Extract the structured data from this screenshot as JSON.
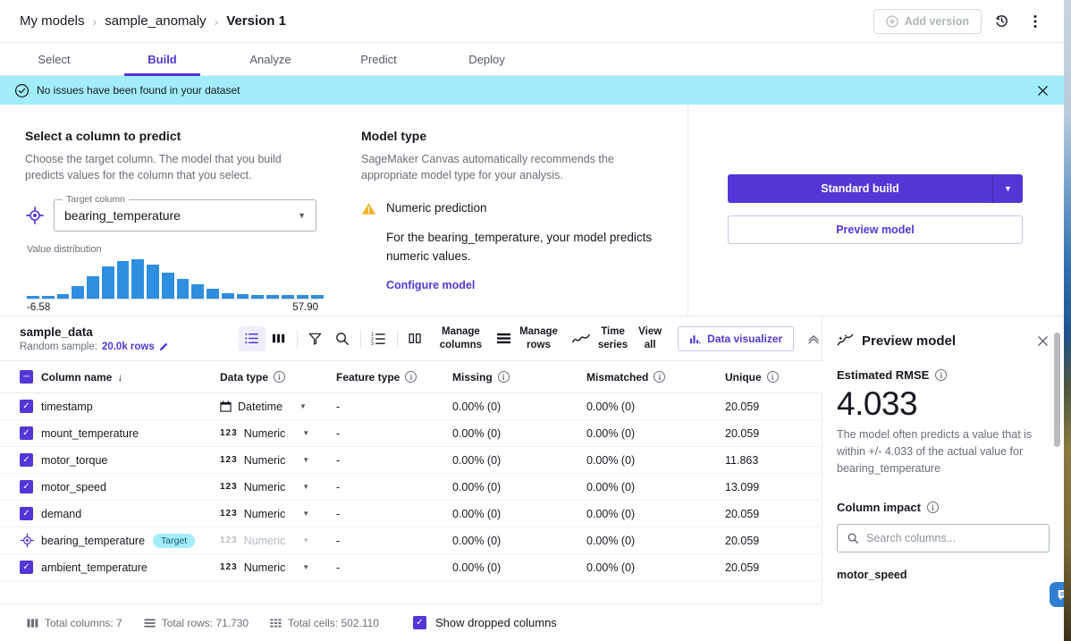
{
  "header": {
    "breadcrumb": [
      {
        "label": "My models",
        "current": false
      },
      {
        "label": "sample_anomaly",
        "current": false
      },
      {
        "label": "Version 1",
        "current": true
      }
    ],
    "add_version_label": "Add version",
    "history_icon": "history-clock-icon",
    "more_icon": "kebab-menu-icon"
  },
  "tabs": [
    {
      "label": "Select",
      "active": false
    },
    {
      "label": "Build",
      "active": true
    },
    {
      "label": "Analyze",
      "active": false
    },
    {
      "label": "Predict",
      "active": false
    },
    {
      "label": "Deploy",
      "active": false
    }
  ],
  "notification": {
    "icon": "check-circle-icon",
    "message": "No issues have been found in your dataset",
    "close_icon": "close-icon",
    "background": "#a2edfb"
  },
  "select_column": {
    "title": "Select a column to predict",
    "description": "Choose the target column. The model that you build predicts values for the column that you select.",
    "target_icon": "target-crosshair-icon",
    "field_label": "Target column",
    "field_value": "bearing_temperature",
    "distribution_label": "Value distribution"
  },
  "model_type": {
    "title": "Model type",
    "description": "SageMaker Canvas automatically recommends the appropriate model type for your analysis.",
    "warning_icon": "warning-triangle-icon",
    "type_label": "Numeric prediction",
    "explanation": "For the bearing_temperature, your model predicts numeric values.",
    "configure_link": "Configure model"
  },
  "build_actions": {
    "primary_label": "Standard build",
    "primary_color": "#5436d6",
    "dropdown_icon": "chevron-down-icon",
    "secondary_label": "Preview model"
  },
  "dataset_toolbar": {
    "name": "sample_data",
    "sample_prefix": "Random sample:",
    "sample_value": "20.0k rows",
    "edit_icon": "pencil-edit-icon",
    "icons": [
      {
        "name": "list-view-icon",
        "active": true
      },
      {
        "name": "column-view-icon",
        "active": false
      },
      {
        "name": "filter-icon",
        "active": false
      },
      {
        "name": "search-icon",
        "active": false
      },
      {
        "name": "ordered-list-icon",
        "active": false
      },
      {
        "name": "split-columns-icon",
        "active": false
      }
    ],
    "manage_columns": "Manage\ncolumns",
    "manage_columns_l1": "Manage",
    "manage_columns_l2": "columns",
    "manage_rows_l1": "Manage",
    "manage_rows_l2": "rows",
    "time_series_l1": "Time",
    "time_series_l2": "series",
    "view_all_l1": "View",
    "view_all_l2": "all",
    "data_visualizer": "Data visualizer",
    "data_visualizer_icon": "bar-chart-icon",
    "collapse_icon": "chevron-double-up-icon",
    "manage_rows_icon": "rows-icon",
    "time_series_icon": "trend-line-icon"
  },
  "table": {
    "columns": [
      {
        "label": "Column name",
        "info": false,
        "sort": "↓"
      },
      {
        "label": "Data type",
        "info": true
      },
      {
        "label": "Feature type",
        "info": true
      },
      {
        "label": "Missing",
        "info": true
      },
      {
        "label": "Mismatched",
        "info": true
      },
      {
        "label": "Unique",
        "info": true
      }
    ],
    "rows": [
      {
        "checked": true,
        "target": false,
        "name": "timestamp",
        "dtype": "Datetime",
        "dtype_icon": "calendar-icon",
        "ftype": "-",
        "missing": "0.00% (0)",
        "mismatched": "0.00% (0)",
        "unique": "20.059"
      },
      {
        "checked": true,
        "target": false,
        "name": "mount_temperature",
        "dtype": "Numeric",
        "dtype_icon": "123-icon",
        "ftype": "-",
        "missing": "0.00% (0)",
        "mismatched": "0.00% (0)",
        "unique": "20.059"
      },
      {
        "checked": true,
        "target": false,
        "name": "motor_torque",
        "dtype": "Numeric",
        "dtype_icon": "123-icon",
        "ftype": "-",
        "missing": "0.00% (0)",
        "mismatched": "0.00% (0)",
        "unique": "11.863"
      },
      {
        "checked": true,
        "target": false,
        "name": "motor_speed",
        "dtype": "Numeric",
        "dtype_icon": "123-icon",
        "ftype": "-",
        "missing": "0.00% (0)",
        "mismatched": "0.00% (0)",
        "unique": "13.099"
      },
      {
        "checked": true,
        "target": false,
        "name": "demand",
        "dtype": "Numeric",
        "dtype_icon": "123-icon",
        "ftype": "-",
        "missing": "0.00% (0)",
        "mismatched": "0.00% (0)",
        "unique": "20.059"
      },
      {
        "checked": true,
        "target": true,
        "target_badge": "Target",
        "name": "bearing_temperature",
        "dtype": "Numeric",
        "dtype_icon": "123-icon",
        "ftype": "-",
        "missing": "0.00% (0)",
        "mismatched": "0.00% (0)",
        "unique": "20.059"
      },
      {
        "checked": true,
        "target": false,
        "name": "ambient_temperature",
        "dtype": "Numeric",
        "dtype_icon": "123-icon",
        "ftype": "-",
        "missing": "0.00% (0)",
        "mismatched": "0.00% (0)",
        "unique": "20.059"
      }
    ]
  },
  "preview_panel": {
    "icon": "model-preview-icon",
    "title": "Preview model",
    "close_icon": "close-icon",
    "rmse_label": "Estimated RMSE",
    "rmse_value": "4.033",
    "rmse_desc": "The model often predicts a value that is within +/- 4.033 of the actual value for bearing_temperature",
    "impact_label": "Column impact",
    "search_placeholder": "Search columns...",
    "search_value": "",
    "search_icon": "search-icon",
    "first_column": "motor_speed",
    "chat_icon": "chat-bubble-icon"
  },
  "footer": {
    "total_columns": "Total columns: 7",
    "total_rows": "Total rows: 71.730",
    "total_cells": "Total cells: 502.110",
    "show_dropped": "Show dropped columns",
    "columns_icon": "columns-icon",
    "rows_icon": "rows-icon",
    "cells_icon": "grid-icon"
  },
  "chart_data": {
    "type": "bar",
    "title": "Value distribution",
    "subtitle": "bearing_temperature",
    "xlabel": "",
    "ylabel": "",
    "grid": false,
    "legend": null,
    "axis_min_label": "-6.58",
    "axis_max_label": "57.90",
    "xlim": [
      -6.58,
      57.9
    ],
    "bar_color": "#2e8fe0",
    "categories": [
      "b1",
      "b2",
      "b3",
      "b4",
      "b5",
      "b6",
      "b7",
      "b8",
      "b9",
      "b10",
      "b11",
      "b12",
      "b13",
      "b14",
      "b15",
      "b16",
      "b17",
      "b18",
      "b19",
      "b20"
    ],
    "values": [
      3,
      3,
      5,
      14,
      26,
      37,
      43,
      45,
      39,
      30,
      22,
      16,
      11,
      6,
      5,
      4,
      4,
      4,
      4,
      4
    ]
  }
}
